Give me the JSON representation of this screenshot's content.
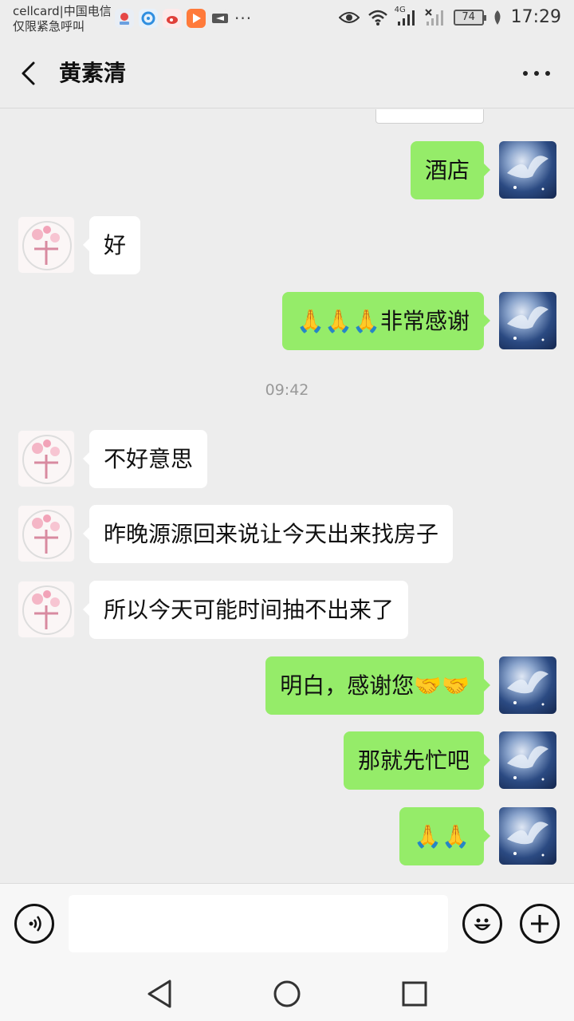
{
  "status_bar": {
    "carrier_line1": "cellcard|中国电信",
    "carrier_line2": "仅限紧急呼叫",
    "network": "4G",
    "battery": "74",
    "time": "17:29"
  },
  "header": {
    "title": "黄素清"
  },
  "messages": [
    {
      "side": "right",
      "text": "酒店"
    },
    {
      "side": "left",
      "text": "好"
    },
    {
      "side": "right",
      "text": "🙏🙏🙏非常感谢"
    },
    {
      "side": "left",
      "text": "不好意思"
    },
    {
      "side": "left",
      "text": "昨晚源源回来说让今天出来找房子"
    },
    {
      "side": "left",
      "text": "所以今天可能时间抽不出来了"
    },
    {
      "side": "right",
      "text": "明白，感谢您🤝🤝"
    },
    {
      "side": "right",
      "text": "那就先忙吧"
    },
    {
      "side": "right",
      "text": "🙏🙏"
    }
  ],
  "timestamp": "09:42",
  "colors": {
    "sent_bubble": "#95ec69",
    "received_bubble": "#ffffff",
    "background": "#ededed"
  },
  "input": {
    "value": "",
    "placeholder": ""
  }
}
